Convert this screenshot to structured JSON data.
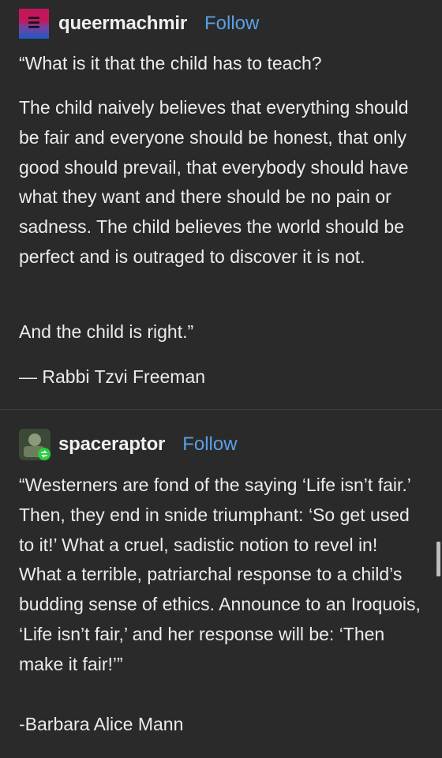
{
  "post1": {
    "username": "queermachmir",
    "follow": "Follow",
    "paragraphs": [
      "“What is it that the child has to teach?",
      "The child naively believes that everything should be fair and everyone should be honest, that only good should prevail, that everybody should have what they want and there should be no pain or sadness. The child believes the world should be perfect and is outraged to discover it is not.",
      "And the child is right.”",
      "— Rabbi Tzvi Freeman"
    ]
  },
  "post2": {
    "username": "spaceraptor",
    "follow": "Follow",
    "paragraphs": [
      "“Westerners are fond of the saying ‘Life isn’t fair.’ Then, they end in snide triumphant: ‘So get used to it!’ What a cruel, sadistic notion to revel in! What a terrible, patriarchal response to a child’s budding sense of ethics. Announce to an Iroquois, ‘Life isn’t fair,’ and her response will be: ‘Then make it fair!’”",
      "-Barbara Alice Mann"
    ]
  }
}
